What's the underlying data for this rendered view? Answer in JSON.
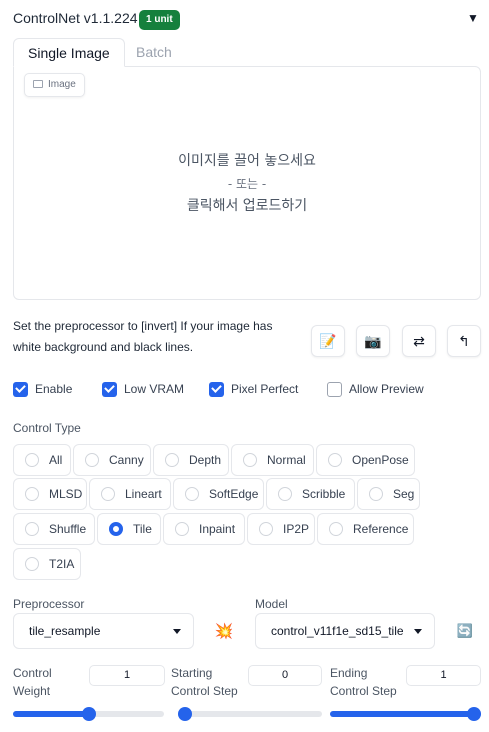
{
  "header": {
    "title": "ControlNet v1.1.224",
    "badge": "1 unit",
    "collapse_icon": "triangle-down-icon"
  },
  "tabs": [
    {
      "label": "Single Image",
      "active": true
    },
    {
      "label": "Batch",
      "active": false
    }
  ],
  "dropzone": {
    "image_label": "Image",
    "line1": "이미지를 끌어 놓으세요",
    "line2": "- 또는 -",
    "line3": "클릭해서 업로드하기"
  },
  "hint": "Set the preprocessor to [invert] If your image has white background and black lines.",
  "tool_buttons": [
    {
      "icon": "edit-icon",
      "glyph": "📝"
    },
    {
      "icon": "camera-icon",
      "glyph": "📷"
    },
    {
      "icon": "swap-icon",
      "glyph": "⇄"
    },
    {
      "icon": "send-icon",
      "glyph": "↰"
    }
  ],
  "checkboxes": [
    {
      "label": "Enable",
      "checked": true
    },
    {
      "label": "Low VRAM",
      "checked": true
    },
    {
      "label": "Pixel Perfect",
      "checked": true
    },
    {
      "label": "Allow Preview",
      "checked": false
    }
  ],
  "control_type": {
    "label": "Control Type",
    "options": [
      "All",
      "Canny",
      "Depth",
      "Normal",
      "OpenPose",
      "MLSD",
      "Lineart",
      "SoftEdge",
      "Scribble",
      "Seg",
      "Shuffle",
      "Tile",
      "Inpaint",
      "IP2P",
      "Reference",
      "T2IA"
    ],
    "selected": "Tile"
  },
  "preprocessor": {
    "label": "Preprocessor",
    "value": "tile_resample",
    "action_icon": "explosion-icon",
    "action_glyph": "💥"
  },
  "model": {
    "label": "Model",
    "value": "control_v11f1e_sd15_tile",
    "refresh_icon": "refresh-icon",
    "refresh_glyph": "🔄"
  },
  "sliders": {
    "weight": {
      "label": "Control Weight",
      "value": "1",
      "fraction": 0.5
    },
    "start": {
      "label": "Starting Control Step",
      "value": "0",
      "fraction": 0.0
    },
    "end": {
      "label": "Ending Control Step",
      "value": "1",
      "fraction": 1.0
    }
  },
  "colors": {
    "accent": "#2563eb",
    "badge": "#15803d"
  }
}
